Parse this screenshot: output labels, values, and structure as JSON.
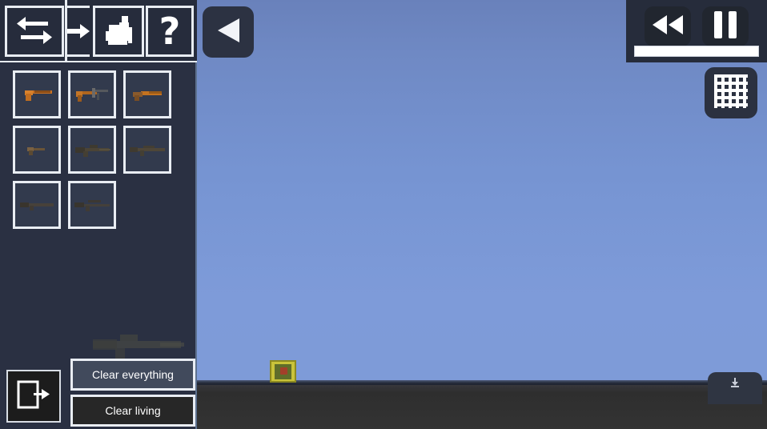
{
  "app": {
    "title": "Sandbox Weapon Spawner",
    "background": {
      "sky_top": "#6981bb",
      "sky_bottom": "#7e9bd8",
      "ground": "#2f2f2f",
      "panel": "#2a3042"
    }
  },
  "toolbar": {
    "items": [
      {
        "name": "swap-arrows-icon",
        "label": "Swap",
        "icon": "swap-arrows-icon"
      },
      {
        "name": "arrow-right-icon",
        "label": "Next",
        "icon": "arrow-right-icon"
      },
      {
        "name": "character-spawn-icon",
        "label": "Spawn Character",
        "icon": "character-spawn-icon"
      },
      {
        "name": "help-icon",
        "label": "?",
        "icon": "question-mark-icon"
      }
    ]
  },
  "weapon_grid": {
    "columns": 3,
    "items": [
      {
        "name": "weapon-pistol",
        "label": "Pistol",
        "tint": "#c87022",
        "kind": "pistol"
      },
      {
        "name": "weapon-smg",
        "label": "SMG",
        "tint": "#b0661f",
        "kind": "smg"
      },
      {
        "name": "weapon-sawed-off",
        "label": "Sawed-off",
        "tint": "#c4721f",
        "kind": "sawed"
      },
      {
        "name": "weapon-revolver",
        "label": "Revolver",
        "tint": "#6a5437",
        "kind": "revolver"
      },
      {
        "name": "weapon-rifle",
        "label": "Rifle",
        "tint": "#4b4436",
        "kind": "rifle"
      },
      {
        "name": "weapon-carbine",
        "label": "Carbine",
        "tint": "#4e4638",
        "kind": "carbine"
      },
      {
        "name": "weapon-shotgun",
        "label": "Shotgun",
        "tint": "#47413a",
        "kind": "shotgun"
      },
      {
        "name": "weapon-sniper",
        "label": "Sniper Rifle",
        "tint": "#44403a",
        "kind": "sniper"
      }
    ]
  },
  "preview": {
    "name": "weapon-preview",
    "label": "Selected weapon preview"
  },
  "sidebar_actions": {
    "exit_label": "Exit",
    "clear_everything_label": "Clear everything",
    "clear_living_label": "Clear living"
  },
  "canvas_controls": {
    "back_label": "Back",
    "grid_toggle_label": "Toggle grid",
    "download_label": "Download"
  },
  "playback": {
    "rewind_label": "Rewind",
    "pause_label": "Pause",
    "timeline_value": "100"
  },
  "world_objects": [
    {
      "name": "crate",
      "label": "Crate",
      "x": "337",
      "y": "450"
    }
  ]
}
